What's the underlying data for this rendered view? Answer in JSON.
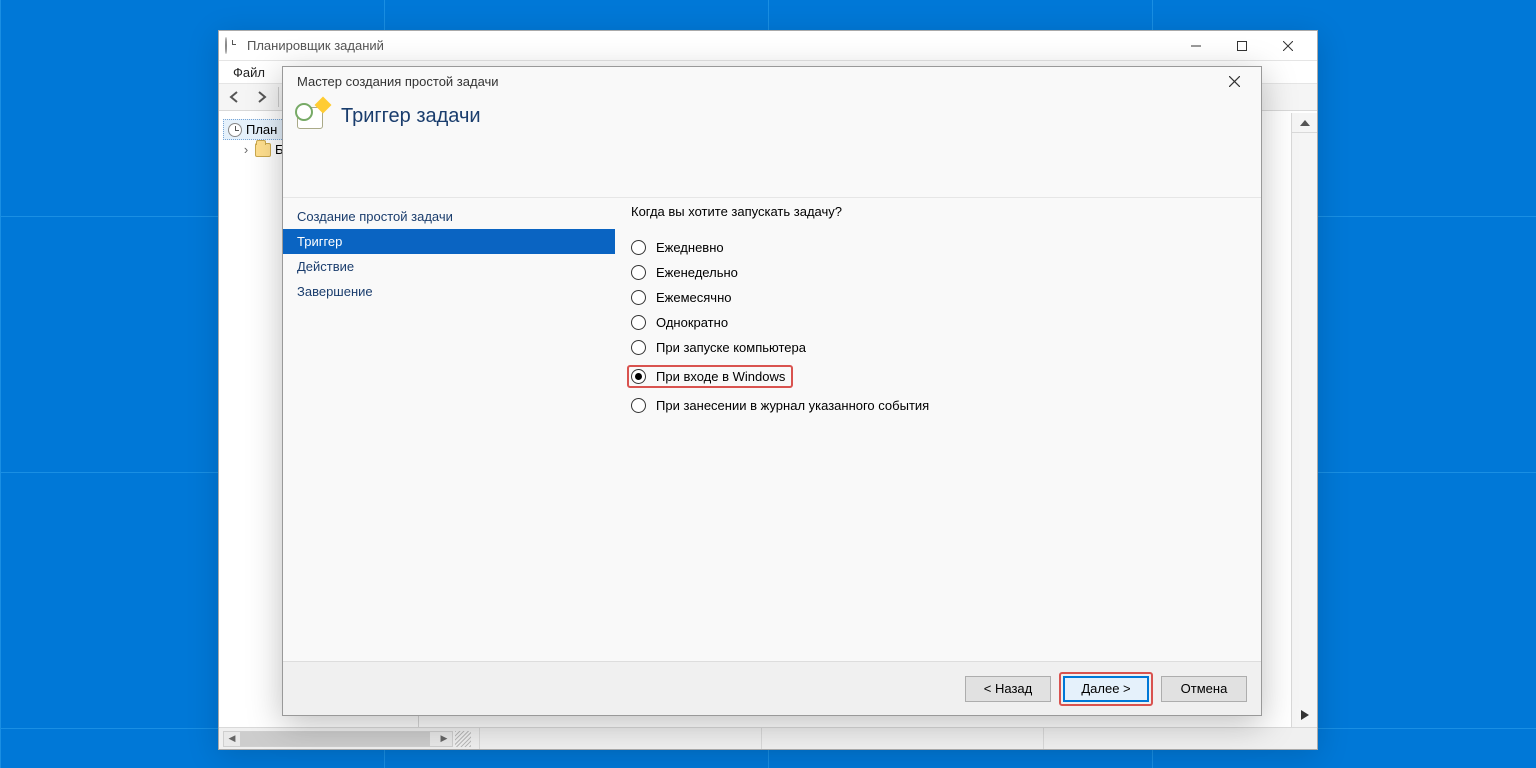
{
  "parent_window": {
    "title": "Планировщик заданий",
    "menu": {
      "file": "Файл"
    },
    "tree": {
      "root_label": "План",
      "child_label": "Б"
    }
  },
  "wizard": {
    "title": "Мастер создания простой задачи",
    "header": "Триггер задачи",
    "steps": [
      "Создание простой задачи",
      "Триггер",
      "Действие",
      "Завершение"
    ],
    "selected_step_index": 1,
    "content": {
      "question": "Когда вы хотите запускать задачу?",
      "options": [
        "Ежедневно",
        "Еженедельно",
        "Ежемесячно",
        "Однократно",
        "При запуске компьютера",
        "При входе в Windows",
        "При занесении в журнал указанного события"
      ],
      "selected_option_index": 5
    },
    "buttons": {
      "back": "< Назад",
      "next": "Далее >",
      "cancel": "Отмена"
    }
  }
}
